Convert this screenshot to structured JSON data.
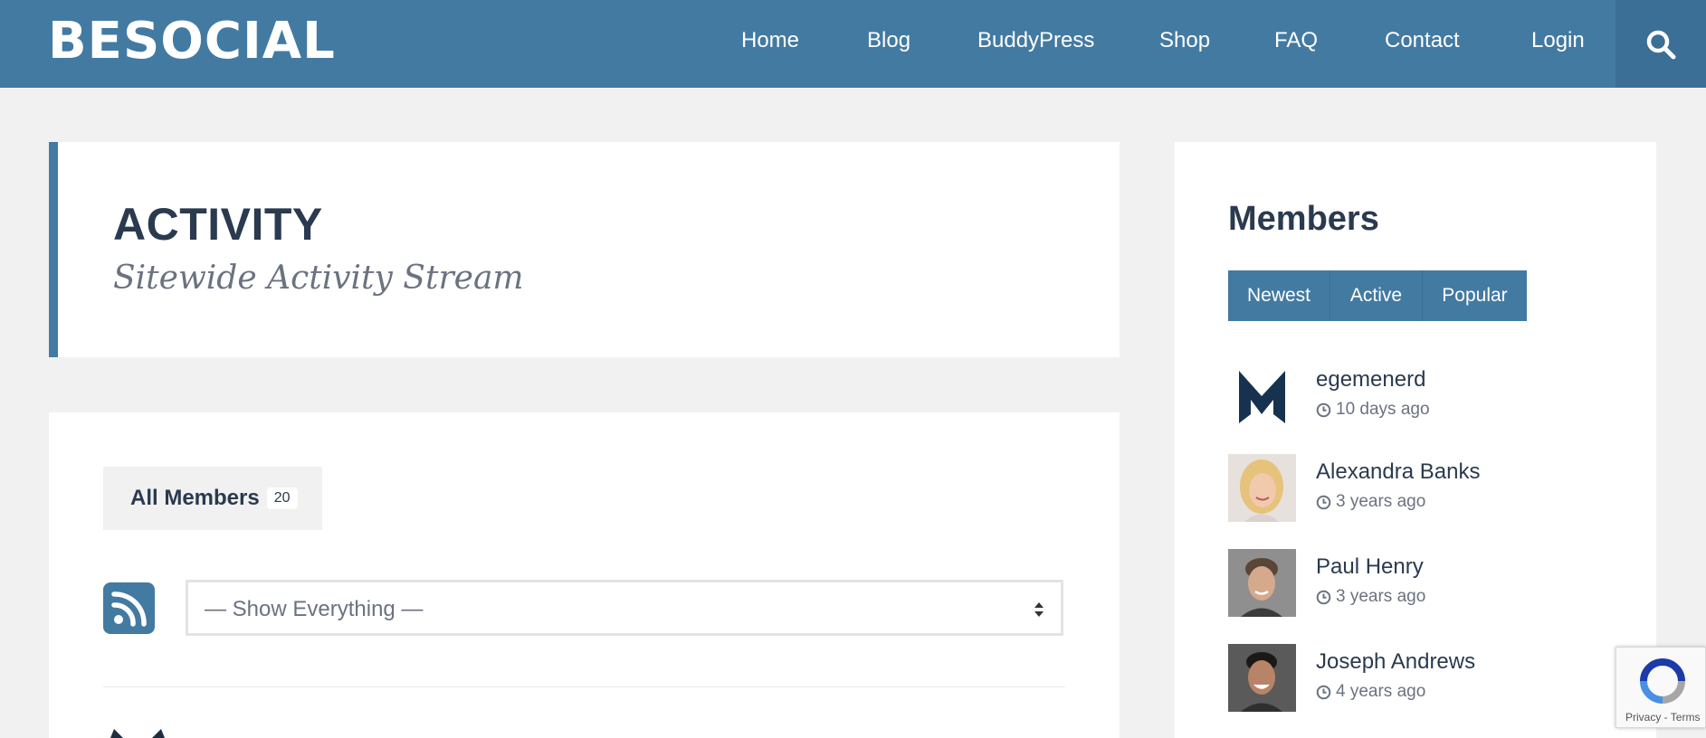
{
  "header": {
    "logo": "BESOCIAL",
    "nav": [
      "Home",
      "Blog",
      "BuddyPress",
      "Shop",
      "FAQ",
      "Contact",
      "Login"
    ],
    "search_icon": "search-icon"
  },
  "activity": {
    "title": "ACTIVITY",
    "subtitle": "Sitewide Activity Stream",
    "tab_label": "All Members",
    "tab_count": "20",
    "rss_icon": "rss-icon",
    "filter_value": "— Show Everything —"
  },
  "members_widget": {
    "title": "Members",
    "tabs": [
      "Newest",
      "Active",
      "Popular"
    ],
    "members": [
      {
        "name": "egemenerd",
        "time": "10 days ago"
      },
      {
        "name": "Alexandra Banks",
        "time": "3 years ago"
      },
      {
        "name": "Paul Henry",
        "time": "3 years ago"
      },
      {
        "name": "Joseph Andrews",
        "time": "4 years ago"
      }
    ]
  },
  "recaptcha": {
    "links": "Privacy - Terms"
  },
  "colors": {
    "header": "#437aa2",
    "accent": "#437aa2",
    "text": "#2a3a4f",
    "muted": "#6b7280",
    "page_bg": "#f1f1f1"
  }
}
